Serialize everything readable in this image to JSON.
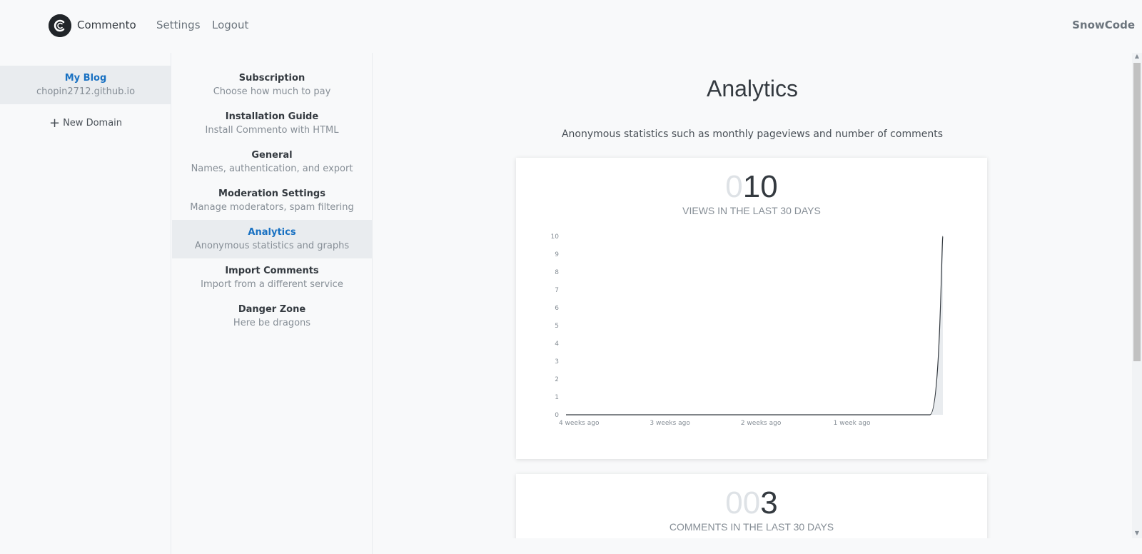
{
  "navbar": {
    "brand": "Commento",
    "links": [
      "Settings",
      "Logout"
    ],
    "user": "SnowCode"
  },
  "domains": {
    "items": [
      {
        "name": "My Blog",
        "url": "chopin2712.github.io"
      }
    ],
    "new_domain": "New Domain"
  },
  "settings_nav": [
    {
      "title": "Subscription",
      "subtitle": "Choose how much to pay"
    },
    {
      "title": "Installation Guide",
      "subtitle": "Install Commento with HTML"
    },
    {
      "title": "General",
      "subtitle": "Names, authentication, and export"
    },
    {
      "title": "Moderation Settings",
      "subtitle": "Manage moderators, spam filtering"
    },
    {
      "title": "Analytics",
      "subtitle": "Anonymous statistics and graphs"
    },
    {
      "title": "Import Comments",
      "subtitle": "Import from a different service"
    },
    {
      "title": "Danger Zone",
      "subtitle": "Here be dragons"
    }
  ],
  "main": {
    "title": "Analytics",
    "description": "Anonymous statistics such as monthly pageviews and number of comments",
    "views": {
      "pad": "0",
      "value": "10",
      "label": "VIEWS IN THE LAST 30 DAYS"
    },
    "comments": {
      "pad": "00",
      "value": "3",
      "label": "COMMENTS IN THE LAST 30 DAYS"
    }
  },
  "colors": {
    "accent": "#1971c2",
    "line": "#343a40",
    "area": "#e9ecef"
  },
  "chart_data": {
    "type": "area",
    "x_tick_labels": [
      "4 weeks ago",
      "3 weeks ago",
      "2 weeks ago",
      "1 week ago"
    ],
    "y_ticks": [
      0,
      1,
      2,
      3,
      4,
      5,
      6,
      7,
      8,
      9,
      10
    ],
    "ylim": [
      0,
      10
    ],
    "series": [
      {
        "values": [
          0,
          0,
          0,
          0,
          0,
          0,
          0,
          0,
          0,
          0,
          0,
          0,
          0,
          0,
          0,
          0,
          0,
          0,
          0,
          0,
          0,
          0,
          0,
          0,
          0,
          0,
          0,
          0,
          0,
          10
        ]
      }
    ],
    "grid": false
  }
}
